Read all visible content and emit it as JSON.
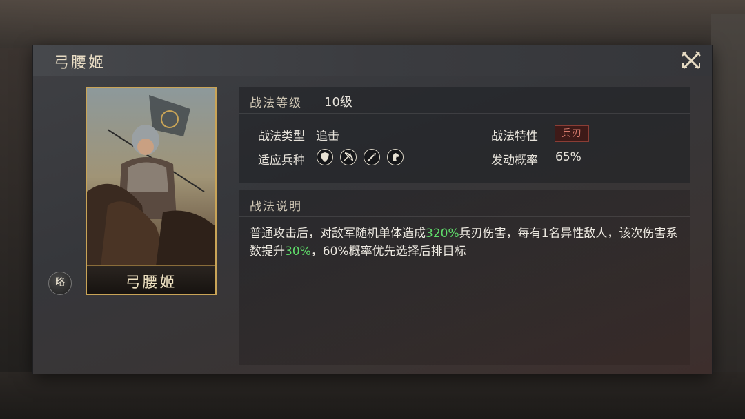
{
  "dialog": {
    "title": "弓腰姬",
    "close_icon": "close-crossed-blades-icon"
  },
  "card": {
    "name": "弓腰姬",
    "badge": "略"
  },
  "info": {
    "level_label": "战法等级",
    "level_value": "10级",
    "type_label": "战法类型",
    "type_value": "追击",
    "trait_label": "战法特性",
    "trait_value": "兵刃",
    "troops_label": "适应兵种",
    "troops": [
      "shield-icon",
      "bow-icon",
      "spear-icon",
      "horse-icon"
    ],
    "rate_label": "发动概率",
    "rate_value": "65%"
  },
  "description": {
    "label": "战法说明",
    "part1": "普通攻击后，对敌军随机单体造成",
    "hl1": "320%",
    "part2": "兵刃伤害，每有1名异性敌人，该次伤害系数提升",
    "hl2": "30%",
    "part3": "，60%概率优先选择后排目标"
  },
  "colors": {
    "highlight": "#5fdc6a",
    "card_border": "#c9a457",
    "trait": "#d77a6c"
  }
}
